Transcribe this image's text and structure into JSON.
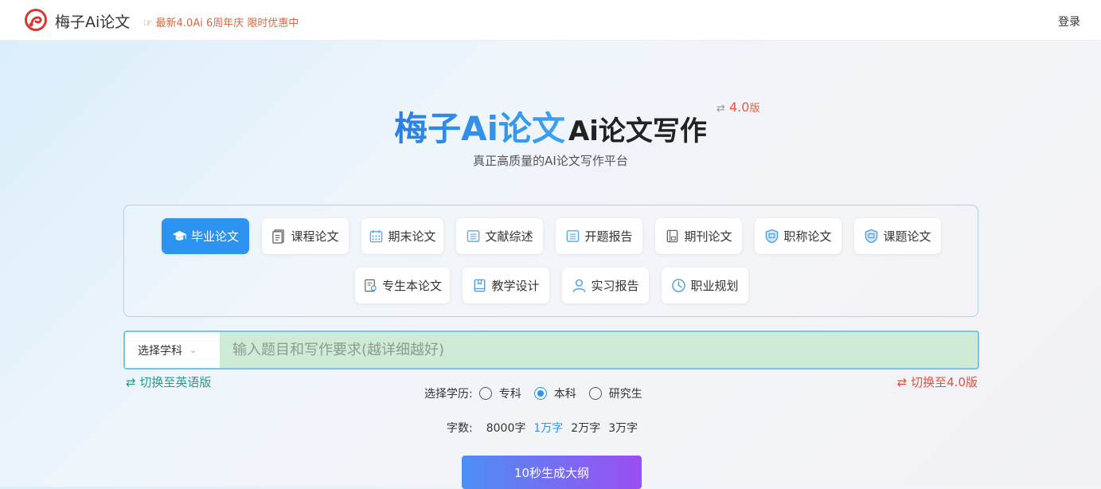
{
  "header": {
    "brand": "梅子Ai论文",
    "promo": "最新4.0Ai 6周年庆 限时优惠中",
    "login": "登录"
  },
  "hero": {
    "title_main": "梅子Ai论文",
    "title_sub": "Ai论文写作",
    "version": "4.0",
    "version_suffix": "版",
    "subtitle": "真正高质量的AI论文写作平台"
  },
  "paper_types": [
    {
      "label": "毕业论文",
      "icon": "graduation-cap-icon",
      "active": true
    },
    {
      "label": "课程论文",
      "icon": "document-icon"
    },
    {
      "label": "期末论文",
      "icon": "calendar-icon"
    },
    {
      "label": "文献综述",
      "icon": "list-icon"
    },
    {
      "label": "开题报告",
      "icon": "list-icon"
    },
    {
      "label": "期刊论文",
      "icon": "journal-icon"
    },
    {
      "label": "职称论文",
      "icon": "shield-icon"
    },
    {
      "label": "课题论文",
      "icon": "shield-icon"
    },
    {
      "label": "专生本论文",
      "icon": "certificate-icon"
    },
    {
      "label": "教学设计",
      "icon": "book-icon"
    },
    {
      "label": "实习报告",
      "icon": "person-icon"
    },
    {
      "label": "职业规划",
      "icon": "clock-icon"
    }
  ],
  "search": {
    "subject_label": "选择学科",
    "placeholder": "输入题目和写作要求(越详细越好)"
  },
  "switch_english": "⇄ 切换至英语版",
  "switch_v4": "⇄ 切换至4.0版",
  "education": {
    "label": "选择学历:",
    "options": [
      "专科",
      "本科",
      "研究生"
    ],
    "selected": "本科"
  },
  "word_count": {
    "label": "字数:",
    "options": [
      "8000字",
      "1万字",
      "2万字",
      "3万字"
    ],
    "selected": "1万字"
  },
  "generate_button": "10秒生成大纲",
  "colors": {
    "accent": "#2d93f0",
    "promo": "#e0643a",
    "switch_en": "#2a9a8a",
    "switch_v4": "#e0523f"
  }
}
